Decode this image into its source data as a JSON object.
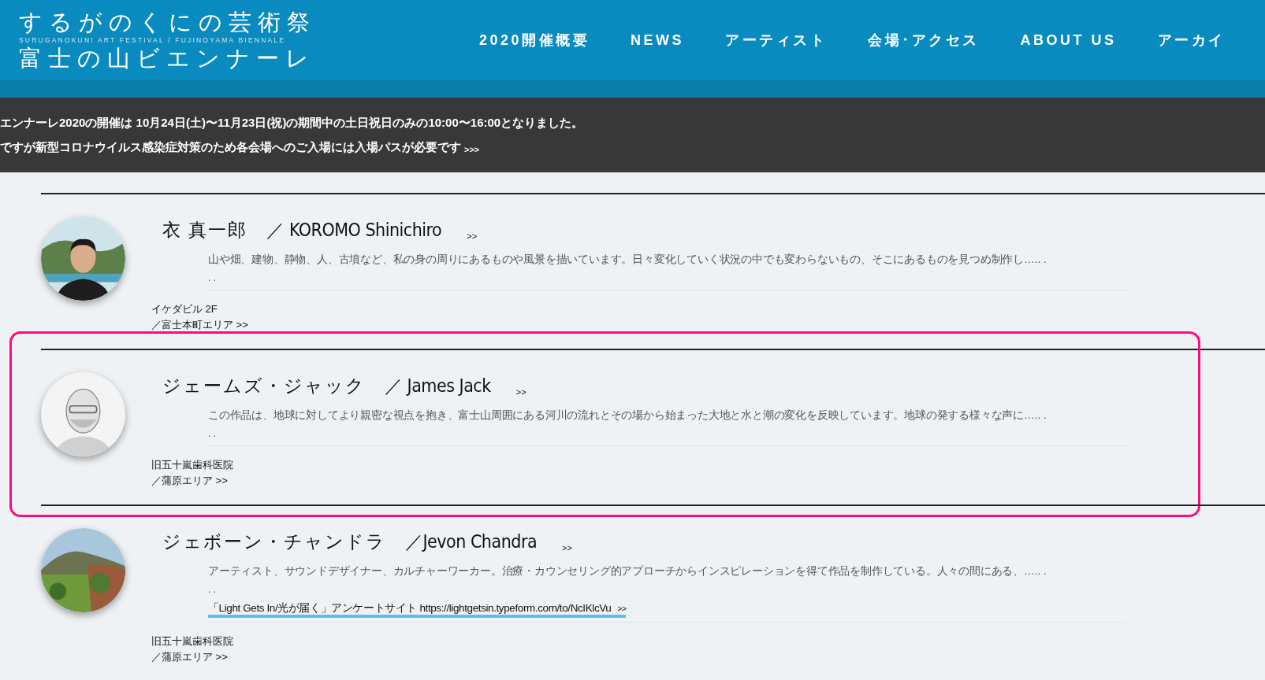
{
  "logo": {
    "title": "するがのくにの芸術祭",
    "subtitle": "SURUGANOKUNI ART FESTIVAL / FUJINOYAMA BIENNALE",
    "name": "富士の山ビエンナーレ"
  },
  "nav": [
    {
      "label": "2020開催概要"
    },
    {
      "label": "NEWS"
    },
    {
      "label": "アーティスト"
    },
    {
      "label": "会場･アクセス"
    },
    {
      "label": "ABOUT US"
    },
    {
      "label": "アーカイ"
    }
  ],
  "notice": {
    "lines": [
      "エンナーレ2020の開催は 10月24日(土)〜11月23日(祝)の期間中の土日祝日のみの10:00〜16:00となりました。",
      "ですが新型コロナウイルス感染症対策のため各会場へのご入場には入場パスが必要です"
    ],
    "more": ">>>"
  },
  "artists": [
    {
      "name_ja": "衣 真一郎",
      "name_en": "／ KOROMO Shinichiro",
      "more": ">>",
      "description": "山や畑、建物、静物、人、古墳など、私の身の周りにあるものや風景を描いています。日々変化していく状況の中でも変わらないもの、そこにあるものを見つめ制作し….. .",
      "ellipsis": ". .",
      "venue": "イケダビル 2F",
      "area": "／富士本町エリア >>",
      "highlighted": false
    },
    {
      "name_ja": "ジェームズ・ジャック",
      "name_en": "／ James Jack",
      "more": ">>",
      "description": "この作品は、地球に対してより親密な視点を抱き、富士山周囲にある河川の流れとその場から始まった大地と水と潮の変化を反映しています。地球の発する様々な声に….. .",
      "ellipsis": ". .",
      "venue": "旧五十嵐歯科医院",
      "area": "／蒲原エリア >>",
      "highlighted": true
    },
    {
      "name_ja": "ジェボーン・チャンドラ",
      "name_en": "／Jevon Chandra",
      "more": ">>",
      "description": "アーティスト、サウンドデザイナー、カルチャーワーカー。治療・カウンセリング的アプローチからインスピレーションを得て作品を制作している。人々の間にある、….. .",
      "ellipsis": ". .",
      "link": {
        "text": "「Light Gets In/光が届く」アンケートサイト https://lightgetsin.typeform.com/to/NcIKlcVu",
        "more": ">>",
        "underlined": true
      },
      "venue": "旧五十嵐歯科医院",
      "area": "／蒲原エリア >>",
      "highlighted": false
    }
  ]
}
